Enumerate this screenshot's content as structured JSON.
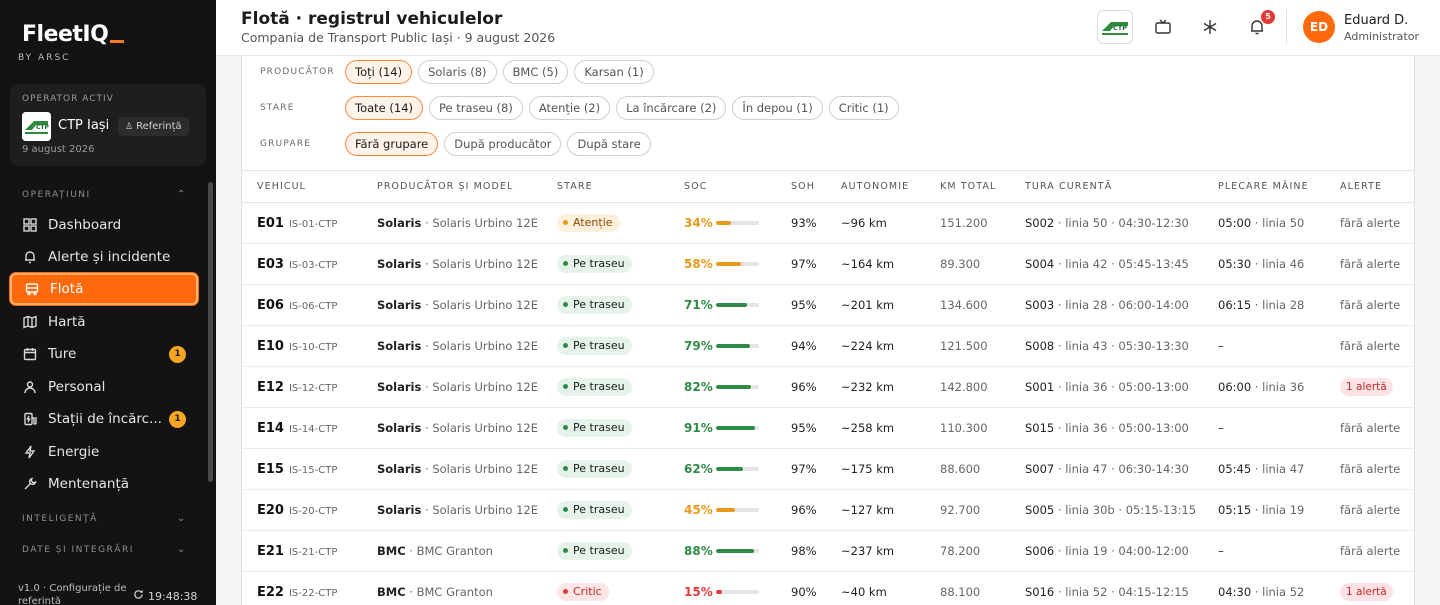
{
  "app": {
    "name": "FleetIQ",
    "by": "BY ARSC"
  },
  "operator": {
    "section_label": "OPERATOR ACTIV",
    "name": "CTP Iași",
    "role_badge": "Referință",
    "date": "9 august 2026"
  },
  "sidebar": {
    "sections": [
      {
        "label": "OPERAȚIUNI",
        "expanded": true
      },
      {
        "label": "INTELIGENȚĂ",
        "expanded": false
      },
      {
        "label": "DATE ȘI INTEGRĂRI",
        "expanded": false
      }
    ],
    "items": [
      {
        "label": "Dashboard",
        "icon": "grid-icon"
      },
      {
        "label": "Alerte și incidente",
        "icon": "bell-icon"
      },
      {
        "label": "Flotă",
        "icon": "bus-icon",
        "active": true
      },
      {
        "label": "Hartă",
        "icon": "map-icon"
      },
      {
        "label": "Ture",
        "icon": "calendar-icon",
        "count": "1"
      },
      {
        "label": "Stații de încărc...",
        "icon": "charging-station-icon",
        "count": "1"
      },
      {
        "label": "Personal",
        "icon": "user-icon"
      },
      {
        "label": "Energie",
        "icon": "bolt-icon"
      },
      {
        "label": "Mentenanță",
        "icon": "wrench-icon"
      }
    ],
    "footer": {
      "version": "v1.0 · Configurație de referință",
      "time": "19:48:38"
    }
  },
  "header": {
    "title": "Flotă · registrul vehiculelor",
    "subtitle": "Compania de Transport Public Iași · 9 august 2026",
    "notifications": "5",
    "user": {
      "initials": "ED",
      "name": "Eduard D.",
      "role": "Administrator"
    }
  },
  "filters": {
    "producer": {
      "label": "PRODUCĂTOR",
      "chips": [
        "Toți (14)",
        "Solaris (8)",
        "BMC (5)",
        "Karsan (1)"
      ],
      "selected": 0
    },
    "status": {
      "label": "STARE",
      "chips": [
        "Toate (14)",
        "Pe traseu (8)",
        "Atenție (2)",
        "La încărcare (2)",
        "În depou (1)",
        "Critic (1)"
      ],
      "selected": 0
    },
    "grouping": {
      "label": "GRUPARE",
      "chips": [
        "Fără grupare",
        "După producător",
        "După stare"
      ],
      "selected": 0
    }
  },
  "table": {
    "columns": [
      "VEHICUL",
      "PRODUCĂTOR ȘI MODEL",
      "STARE",
      "SOC",
      "SOH",
      "AUTONOMIE",
      "KM TOTAL",
      "TURA CURENTĂ",
      "PLECARE MÂINE",
      "ALERTE"
    ],
    "rows": [
      {
        "id": "E01",
        "plate": "IS-01-CTP",
        "brand": "Solaris",
        "model": "Solaris Urbino 12E",
        "status": "Atenție",
        "status_kind": "amber",
        "soc": "34%",
        "soc_value": 34,
        "soh": "93%",
        "range": "~96 km",
        "km": "151.200",
        "shift_code": "S002",
        "shift_rest": "linia 50 · 04:30-12:30",
        "dep_time": "05:00",
        "dep_line": "linia 50",
        "alerts": "fără alerte",
        "alert_flag": false
      },
      {
        "id": "E03",
        "plate": "IS-03-CTP",
        "brand": "Solaris",
        "model": "Solaris Urbino 12E",
        "status": "Pe traseu",
        "status_kind": "green",
        "soc": "58%",
        "soc_value": 58,
        "soh": "97%",
        "range": "~164 km",
        "km": "89.300",
        "shift_code": "S004",
        "shift_rest": "linia 42 · 05:45-13:45",
        "dep_time": "05:30",
        "dep_line": "linia 46",
        "alerts": "fără alerte",
        "alert_flag": false
      },
      {
        "id": "E06",
        "plate": "IS-06-CTP",
        "brand": "Solaris",
        "model": "Solaris Urbino 12E",
        "status": "Pe traseu",
        "status_kind": "green",
        "soc": "71%",
        "soc_value": 71,
        "soh": "95%",
        "range": "~201 km",
        "km": "134.600",
        "shift_code": "S003",
        "shift_rest": "linia 28 · 06:00-14:00",
        "dep_time": "06:15",
        "dep_line": "linia 28",
        "alerts": "fără alerte",
        "alert_flag": false
      },
      {
        "id": "E10",
        "plate": "IS-10-CTP",
        "brand": "Solaris",
        "model": "Solaris Urbino 12E",
        "status": "Pe traseu",
        "status_kind": "green",
        "soc": "79%",
        "soc_value": 79,
        "soh": "94%",
        "range": "~224 km",
        "km": "121.500",
        "shift_code": "S008",
        "shift_rest": "linia 43 · 05:30-13:30",
        "dep_time": "–",
        "dep_line": "",
        "alerts": "fără alerte",
        "alert_flag": false
      },
      {
        "id": "E12",
        "plate": "IS-12-CTP",
        "brand": "Solaris",
        "model": "Solaris Urbino 12E",
        "status": "Pe traseu",
        "status_kind": "green",
        "soc": "82%",
        "soc_value": 82,
        "soh": "96%",
        "range": "~232 km",
        "km": "142.800",
        "shift_code": "S001",
        "shift_rest": "linia 36 · 05:00-13:00",
        "dep_time": "06:00",
        "dep_line": "linia 36",
        "alerts": "1 alertă",
        "alert_flag": true
      },
      {
        "id": "E14",
        "plate": "IS-14-CTP",
        "brand": "Solaris",
        "model": "Solaris Urbino 12E",
        "status": "Pe traseu",
        "status_kind": "green",
        "soc": "91%",
        "soc_value": 91,
        "soh": "95%",
        "range": "~258 km",
        "km": "110.300",
        "shift_code": "S015",
        "shift_rest": "linia 36 · 05:00-13:00",
        "dep_time": "–",
        "dep_line": "",
        "alerts": "fără alerte",
        "alert_flag": false
      },
      {
        "id": "E15",
        "plate": "IS-15-CTP",
        "brand": "Solaris",
        "model": "Solaris Urbino 12E",
        "status": "Pe traseu",
        "status_kind": "green",
        "soc": "62%",
        "soc_value": 62,
        "soh": "97%",
        "range": "~175 km",
        "km": "88.600",
        "shift_code": "S007",
        "shift_rest": "linia 47 · 06:30-14:30",
        "dep_time": "05:45",
        "dep_line": "linia 47",
        "alerts": "fără alerte",
        "alert_flag": false
      },
      {
        "id": "E20",
        "plate": "IS-20-CTP",
        "brand": "Solaris",
        "model": "Solaris Urbino 12E",
        "status": "Pe traseu",
        "status_kind": "green",
        "soc": "45%",
        "soc_value": 45,
        "soh": "96%",
        "range": "~127 km",
        "km": "92.700",
        "shift_code": "S005",
        "shift_rest": "linia 30b · 05:15-13:15",
        "dep_time": "05:15",
        "dep_line": "linia 19",
        "alerts": "fără alerte",
        "alert_flag": false
      },
      {
        "id": "E21",
        "plate": "IS-21-CTP",
        "brand": "BMC",
        "model": "BMC Granton",
        "status": "Pe traseu",
        "status_kind": "green",
        "soc": "88%",
        "soc_value": 88,
        "soh": "98%",
        "range": "~237 km",
        "km": "78.200",
        "shift_code": "S006",
        "shift_rest": "linia 19 · 04:00-12:00",
        "dep_time": "–",
        "dep_line": "",
        "alerts": "fără alerte",
        "alert_flag": false
      },
      {
        "id": "E22",
        "plate": "IS-22-CTP",
        "brand": "BMC",
        "model": "BMC Granton",
        "status": "Critic",
        "status_kind": "red",
        "soc": "15%",
        "soc_value": 15,
        "soh": "90%",
        "range": "~40 km",
        "km": "88.100",
        "shift_code": "S016",
        "shift_rest": "linia 52 · 04:15-12:15",
        "dep_time": "04:30",
        "dep_line": "linia 52",
        "alerts": "1 alertă",
        "alert_flag": true
      }
    ]
  },
  "colors": {
    "accent": "#ff6a0d",
    "soc_high": "#2e8b45",
    "soc_mid": "#e89a1c",
    "soc_low": "#e53935"
  }
}
